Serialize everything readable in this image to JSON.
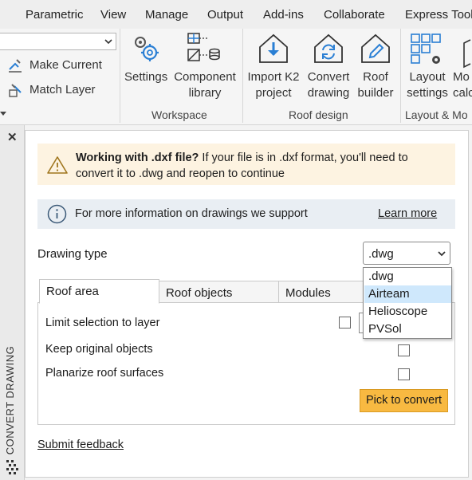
{
  "menubar": {
    "items": [
      "View",
      "Parametric",
      "View",
      "Manage",
      "Output",
      "Add-ins",
      "Collaborate",
      "Express Tools"
    ]
  },
  "ribbon": {
    "layer": {
      "make_current": "Make Current",
      "match_layer": "Match Layer"
    },
    "workspace": {
      "group_label": "Workspace",
      "settings_label": "Settings",
      "component_library_line1": "Component",
      "component_library_line2": "library"
    },
    "roof_design": {
      "group_label": "Roof design",
      "import_line1": "Import K2",
      "import_line2": "project",
      "convert_line1": "Convert",
      "convert_line2": "drawing",
      "builder_line1": "Roof",
      "builder_line2": "builder"
    },
    "layout": {
      "group_label": "Layout & Mo",
      "layout_line1": "Layout",
      "layout_line2": "settings",
      "more_line1": "Mo",
      "more_line2": "calc"
    }
  },
  "palette": {
    "vertical_title": "CONVERT DRAWING",
    "close_glyph": "✕"
  },
  "panel": {
    "warning": {
      "bold": "Working with .dxf file?",
      "text_line1": " If your file is in .dxf format, you'll need to",
      "text_line2": "convert it to .dwg and reopen to continue"
    },
    "info": {
      "text": "For more information on drawings we support",
      "link": "Learn more"
    },
    "drawing_type": {
      "label": "Drawing type",
      "selected": ".dwg",
      "options": [
        ".dwg",
        "Airteam",
        "Helioscope",
        "PVSol"
      ],
      "highlighted_index": 1
    },
    "tabs": [
      "Roof area",
      "Roof objects",
      "Modules"
    ],
    "options": {
      "limit_selection": "Limit selection to layer",
      "keep_original": "Keep original objects",
      "planarize": "Planarize roof surfaces"
    },
    "pick_button": "Pick to convert",
    "feedback_link": "Submit feedback"
  },
  "colors": {
    "accent_button": "#f8b941",
    "warning_bg": "#fdf3e1",
    "info_bg": "#e9eef3",
    "dropdown_highlight": "#cfe8fc",
    "icon_blue": "#2a7fd4"
  }
}
